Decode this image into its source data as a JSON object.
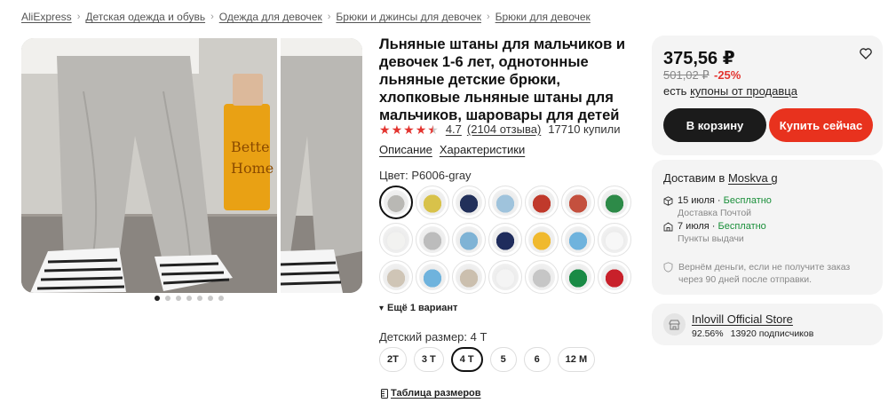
{
  "breadcrumb": [
    "AliExpress",
    "Детская одежда и обувь",
    "Одежда для девочек",
    "Брюки и джинсы для девочек",
    "Брюки для девочек"
  ],
  "product": {
    "title": "Льняные штаны для мальчиков и девочек 1-6 лет, однотонные льняные детские брюки, хлопковые льняные штаны для мальчиков, шаровары для детей",
    "rating": "4.7",
    "rating_value": 4.7,
    "reviews": "(2104 отзыва)",
    "sold": "17710 купили"
  },
  "tabs": [
    "Описание",
    "Характеристики"
  ],
  "gallery": {
    "dots_total": 7,
    "active_dot": 0,
    "photo_sign_text": [
      "Bette",
      "Home"
    ]
  },
  "color": {
    "label": "Цвет: P6006-gray",
    "swatches": [
      {
        "name": "gray",
        "color": "#b9b8b4",
        "selected": true
      },
      {
        "name": "light-gray-yellow",
        "color": "#d8c24a"
      },
      {
        "name": "navy",
        "color": "#22305a"
      },
      {
        "name": "light-blue",
        "color": "#9fc3dc"
      },
      {
        "name": "red-white",
        "color": "#c0392b"
      },
      {
        "name": "rust",
        "color": "#c4503e"
      },
      {
        "name": "green",
        "color": "#2d8a48"
      },
      {
        "name": "white",
        "color": "#f2f2f0"
      },
      {
        "name": "gray-top",
        "color": "#bcbcbc"
      },
      {
        "name": "blue-top",
        "color": "#7fb3d5"
      },
      {
        "name": "navy-top",
        "color": "#1f2c5c"
      },
      {
        "name": "yellow-top",
        "color": "#f0b92e"
      },
      {
        "name": "sky-tee",
        "color": "#6fb3dd"
      },
      {
        "name": "white-tee",
        "color": "#f7f7f7"
      },
      {
        "name": "beige-tee",
        "color": "#cfc5b6"
      },
      {
        "name": "blue-shorts",
        "color": "#6fb3dd"
      },
      {
        "name": "khaki-shorts",
        "color": "#cbbfae"
      },
      {
        "name": "white-shorts",
        "color": "#f4f4f4"
      },
      {
        "name": "gray-shorts",
        "color": "#c6c6c6"
      },
      {
        "name": "green-shorts",
        "color": "#198a45"
      },
      {
        "name": "red-shorts",
        "color": "#c8202a"
      }
    ],
    "more_label": "Ещё 1 вариант"
  },
  "size": {
    "label": "Детский размер: 4 T",
    "options": [
      "2T",
      "3 T",
      "4 T",
      "5",
      "6",
      "12 M"
    ],
    "selected_index": 2,
    "table_link": "Таблица размеров"
  },
  "price_card": {
    "price": "375,56 ₽",
    "old_price": "501,02 ₽",
    "discount": "-25%",
    "coupon_prefix": "есть ",
    "coupon_link": "купоны от продавца",
    "cart_label": "В корзину",
    "buy_label": "Купить сейчас"
  },
  "delivery": {
    "prefix": "Доставим в ",
    "city": "Moskva g",
    "options": [
      {
        "date": "15 июля · ",
        "price": "Бесплатно",
        "method": "Доставка Почтой"
      },
      {
        "date": "7 июля · ",
        "price": "Бесплатно",
        "method": "Пункты выдачи"
      }
    ],
    "refund": "Вернём деньги, если не получите заказ через 90 дней после отправки."
  },
  "store": {
    "name": "Inlovill Official Store",
    "rating": "92.56%",
    "followers": "13920 подписчиков"
  },
  "colors": {
    "accent": "#e8321e",
    "discount": "#e3342f",
    "free": "#1a8f3a",
    "dark_button": "#1b1b1b"
  }
}
